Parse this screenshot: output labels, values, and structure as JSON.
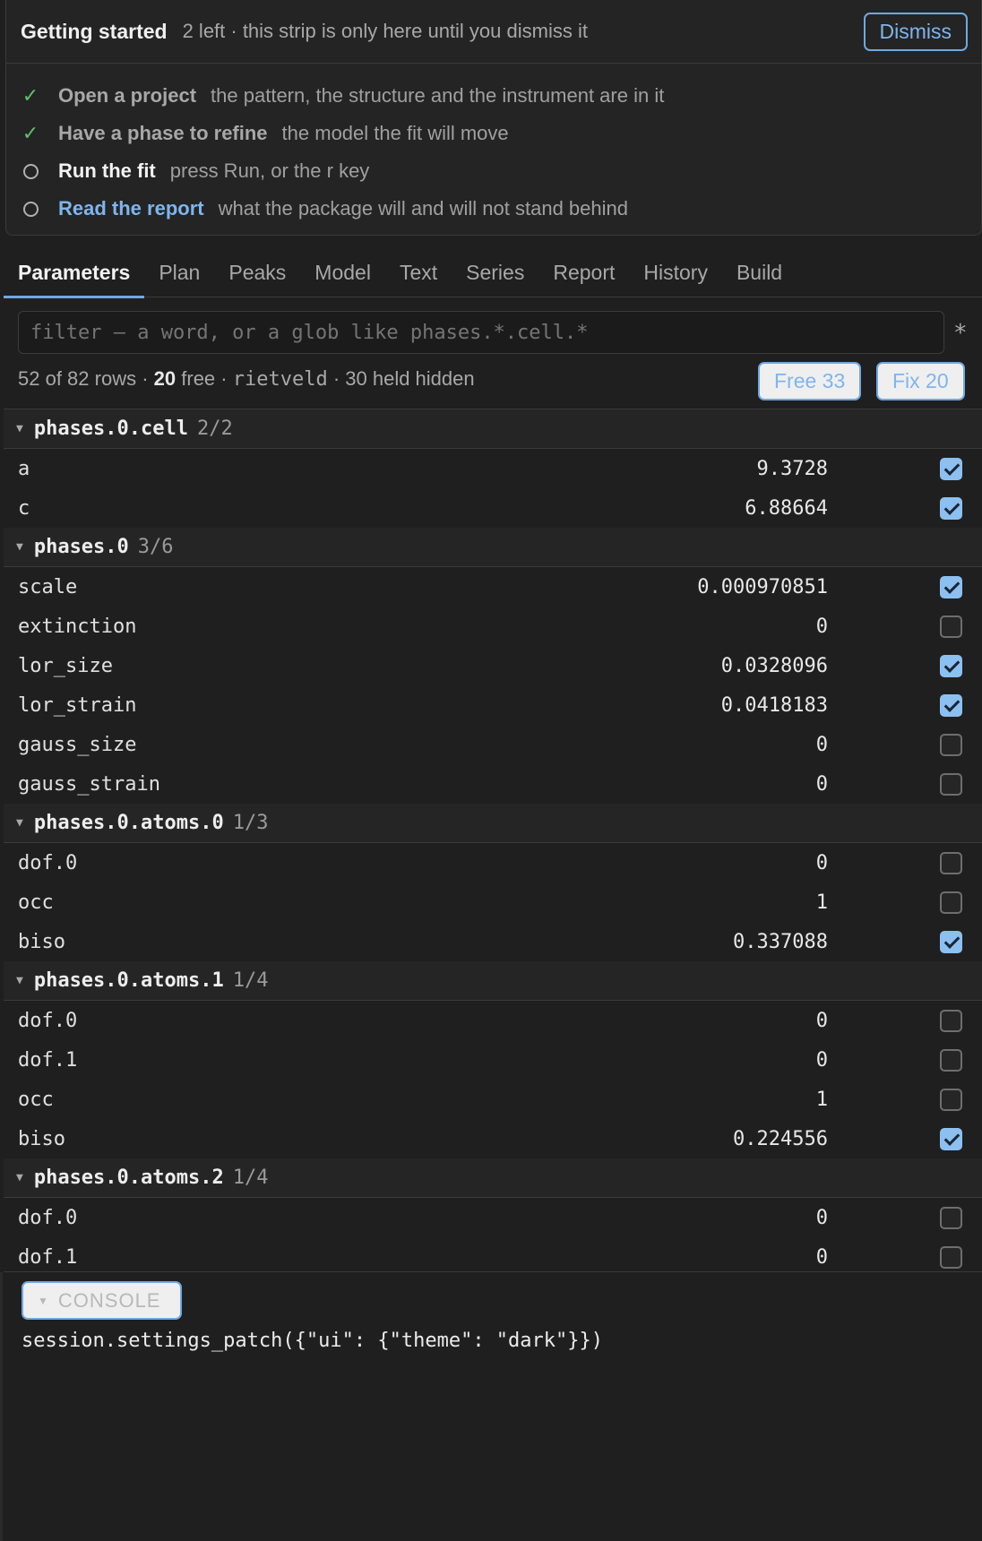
{
  "onboarding": {
    "title": "Getting started",
    "subtitle": "2 left · this strip is only here until you dismiss it",
    "dismiss_label": "Dismiss",
    "steps": [
      {
        "label": "Open a project",
        "desc": "the pattern, the structure and the instrument are in it",
        "state": "done"
      },
      {
        "label": "Have a phase to refine",
        "desc": "the model the fit will move",
        "state": "done"
      },
      {
        "label": "Run the fit",
        "desc": "press Run, or the r key",
        "state": "todo"
      },
      {
        "label": "Read the report",
        "desc": "what the package will and will not stand behind",
        "state": "link"
      }
    ]
  },
  "tabs": [
    "Parameters",
    "Plan",
    "Peaks",
    "Model",
    "Text",
    "Series",
    "Report",
    "History",
    "Build"
  ],
  "active_tab": "Parameters",
  "filter": {
    "placeholder": "filter — a word, or a glob like phases.*.cell.*",
    "glob_symbol": "*"
  },
  "summary": {
    "rows": "52 of 82 rows",
    "free_count": "20",
    "free_word": "free",
    "engine": "rietveld",
    "hidden": "30 held hidden",
    "free_button": "Free 33",
    "fix_button": "Fix 20"
  },
  "groups": [
    {
      "name": "phases.0.cell",
      "count": "2/2",
      "rows": [
        {
          "name": "a",
          "value": "9.3728",
          "refined": true
        },
        {
          "name": "c",
          "value": "6.88664",
          "refined": true
        }
      ]
    },
    {
      "name": "phases.0",
      "count": "3/6",
      "rows": [
        {
          "name": "scale",
          "value": "0.000970851",
          "refined": true
        },
        {
          "name": "extinction",
          "value": "0",
          "refined": false
        },
        {
          "name": "lor_size",
          "value": "0.0328096",
          "refined": true
        },
        {
          "name": "lor_strain",
          "value": "0.0418183",
          "refined": true
        },
        {
          "name": "gauss_size",
          "value": "0",
          "refined": false
        },
        {
          "name": "gauss_strain",
          "value": "0",
          "refined": false
        }
      ]
    },
    {
      "name": "phases.0.atoms.0",
      "count": "1/3",
      "rows": [
        {
          "name": "dof.0",
          "value": "0",
          "refined": false
        },
        {
          "name": "occ",
          "value": "1",
          "refined": false
        },
        {
          "name": "biso",
          "value": "0.337088",
          "refined": true
        }
      ]
    },
    {
      "name": "phases.0.atoms.1",
      "count": "1/4",
      "rows": [
        {
          "name": "dof.0",
          "value": "0",
          "refined": false
        },
        {
          "name": "dof.1",
          "value": "0",
          "refined": false
        },
        {
          "name": "occ",
          "value": "1",
          "refined": false
        },
        {
          "name": "biso",
          "value": "0.224556",
          "refined": true
        }
      ]
    },
    {
      "name": "phases.0.atoms.2",
      "count": "1/4",
      "rows": [
        {
          "name": "dof.0",
          "value": "0",
          "refined": false
        },
        {
          "name": "dof.1",
          "value": "0",
          "refined": false
        }
      ]
    }
  ],
  "console": {
    "toggle_label": "CONSOLE",
    "line": "session.settings_patch({\"ui\": {\"theme\": \"dark\"}})"
  },
  "colors": {
    "accent": "#6fa8e0",
    "check": "#5fbf6a",
    "checkbox_on": "#8cc0f0",
    "background": "#1f1f1f"
  }
}
